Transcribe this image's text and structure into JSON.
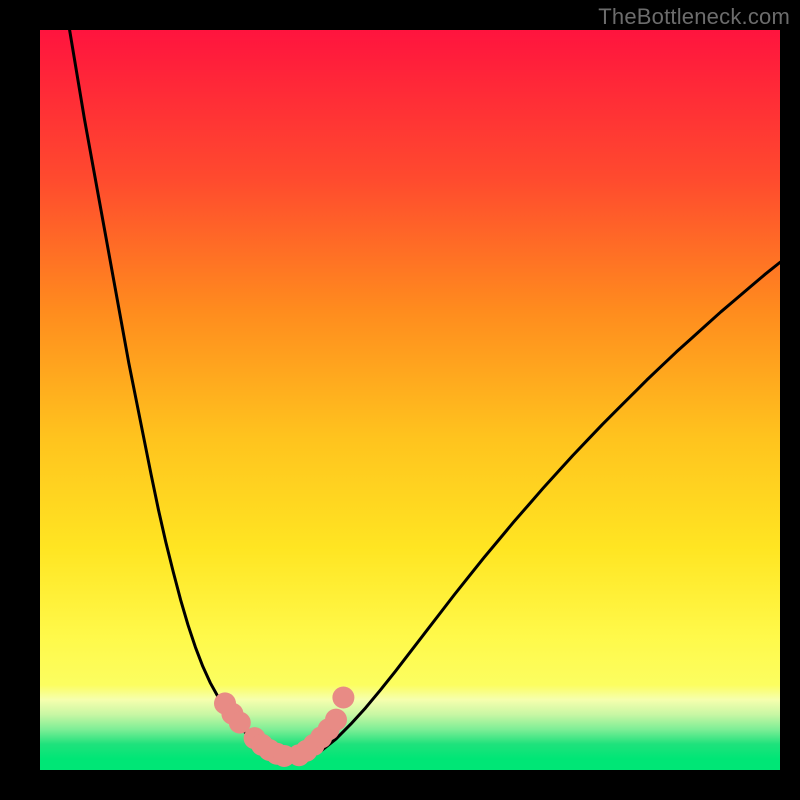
{
  "watermark": "TheBottleneck.com",
  "colors": {
    "page_bg": "#000000",
    "gradient_top": "#ff143e",
    "gradient_mid_upper": "#ff8c1e",
    "gradient_mid": "#ffe522",
    "gradient_lower": "#fcfe60",
    "gradient_band_green": "#1fe27c",
    "gradient_bottom_green": "#00e676",
    "curve_color": "#000000",
    "marker_color": "#e88b85",
    "watermark_color": "#6c6c6c"
  },
  "chart_data": {
    "type": "line",
    "title": "",
    "xlabel": "",
    "ylabel": "",
    "xlim": [
      0,
      100
    ],
    "ylim": [
      0,
      100
    ],
    "x": [
      4,
      5,
      6,
      7,
      8,
      9,
      10,
      11,
      12,
      13,
      14,
      15,
      16,
      17,
      18,
      19,
      20,
      21,
      22,
      23,
      24,
      25,
      26,
      27,
      28,
      29,
      30,
      31,
      32,
      33,
      34,
      35,
      36,
      37,
      38,
      40,
      42,
      44,
      46,
      48,
      50,
      52,
      54,
      56,
      58,
      60,
      62,
      64,
      66,
      68,
      70,
      72,
      74,
      76,
      78,
      80,
      82,
      84,
      86,
      88,
      90,
      92,
      94,
      96,
      98,
      100
    ],
    "y": [
      100,
      94,
      88,
      82.5,
      77,
      71.5,
      66,
      60.5,
      55,
      50,
      45,
      40,
      35.2,
      30.8,
      26.8,
      23,
      19.6,
      16.6,
      14,
      11.8,
      10,
      8.4,
      7,
      5.8,
      4.8,
      3.9,
      3.1,
      2.5,
      2,
      1.6,
      1.4,
      1.4,
      1.6,
      2,
      2.6,
      4.2,
      6.2,
      8.4,
      10.8,
      13.3,
      15.9,
      18.5,
      21.1,
      23.7,
      26.2,
      28.7,
      31.1,
      33.5,
      35.8,
      38.1,
      40.3,
      42.5,
      44.6,
      46.7,
      48.7,
      50.7,
      52.7,
      54.6,
      56.5,
      58.3,
      60.1,
      61.9,
      63.6,
      65.3,
      67,
      68.6
    ],
    "markers": {
      "x": [
        25,
        26,
        27,
        29,
        30,
        31,
        32,
        33,
        35,
        36,
        37,
        38,
        39,
        40,
        41
      ],
      "y": [
        9.0,
        7.6,
        6.4,
        4.3,
        3.4,
        2.7,
        2.2,
        1.9,
        2.0,
        2.6,
        3.4,
        4.4,
        5.5,
        6.8,
        9.8
      ]
    }
  }
}
